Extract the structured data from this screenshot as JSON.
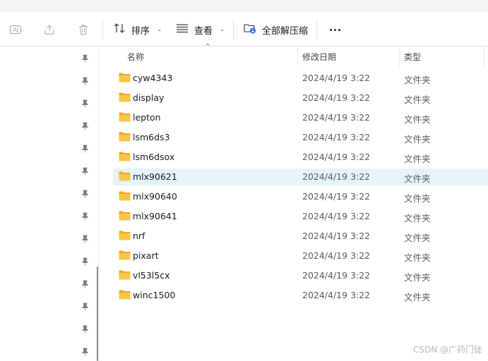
{
  "toolbar": {
    "sort_label": "排序",
    "view_label": "查看",
    "extract_label": "全部解压缩"
  },
  "columns": {
    "name": "名称",
    "date": "修改日期",
    "type": "类型"
  },
  "files": [
    {
      "name": "cyw4343",
      "date": "2024/4/19 3:22",
      "type": "文件夹",
      "selected": false
    },
    {
      "name": "display",
      "date": "2024/4/19 3:22",
      "type": "文件夹",
      "selected": false
    },
    {
      "name": "lepton",
      "date": "2024/4/19 3:22",
      "type": "文件夹",
      "selected": false
    },
    {
      "name": "lsm6ds3",
      "date": "2024/4/19 3:22",
      "type": "文件夹",
      "selected": false
    },
    {
      "name": "lsm6dsox",
      "date": "2024/4/19 3:22",
      "type": "文件夹",
      "selected": false
    },
    {
      "name": "mlx90621",
      "date": "2024/4/19 3:22",
      "type": "文件夹",
      "selected": true
    },
    {
      "name": "mlx90640",
      "date": "2024/4/19 3:22",
      "type": "文件夹",
      "selected": false
    },
    {
      "name": "mlx90641",
      "date": "2024/4/19 3:22",
      "type": "文件夹",
      "selected": false
    },
    {
      "name": "nrf",
      "date": "2024/4/19 3:22",
      "type": "文件夹",
      "selected": false
    },
    {
      "name": "pixart",
      "date": "2024/4/19 3:22",
      "type": "文件夹",
      "selected": false
    },
    {
      "name": "vl53l5cx",
      "date": "2024/4/19 3:22",
      "type": "文件夹",
      "selected": false
    },
    {
      "name": "winc1500",
      "date": "2024/4/19 3:22",
      "type": "文件夹",
      "selected": false
    }
  ],
  "watermark": "CSDN @广药门徒",
  "colors": {
    "selected_row": "#e5f3fb",
    "folder_yellow": "#f8c54a",
    "accent_blue": "#1e6fd9"
  }
}
